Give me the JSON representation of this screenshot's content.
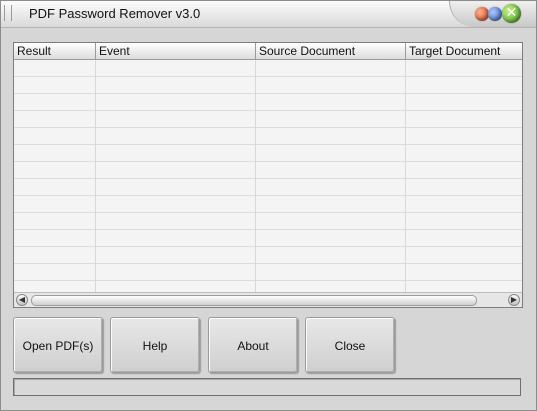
{
  "window": {
    "title": "PDF Password Remover v3.0"
  },
  "titlebar_buttons": {
    "close_glyph": "✕"
  },
  "list": {
    "columns": [
      "Result",
      "Event",
      "Source Document",
      "Target Document"
    ],
    "rows": []
  },
  "scrollbar": {
    "left_glyph": "◀",
    "right_glyph": "▶"
  },
  "buttons": {
    "open_label": "Open PDF(s)",
    "help_label": "Help",
    "about_label": "About",
    "close_label": "Close"
  },
  "status": {
    "text": ""
  },
  "icons": [
    "minimize-icon",
    "maximize-icon",
    "close-icon",
    "scroll-left-icon",
    "scroll-right-icon"
  ]
}
